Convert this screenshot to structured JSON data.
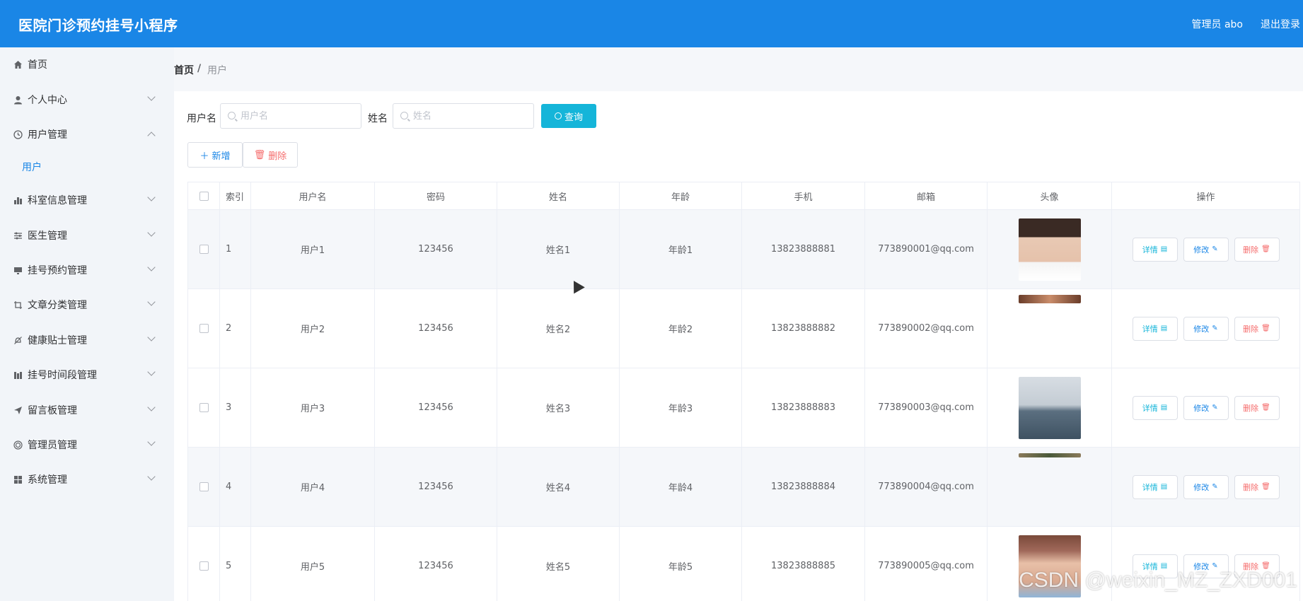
{
  "header": {
    "title": "医院门诊预约挂号小程序",
    "user": "管理员 abo",
    "logout": "退出登录",
    "bg_color": "#1a86e6"
  },
  "sidebar": {
    "items": [
      {
        "label": "首页",
        "icon": "home-icon",
        "expandable": false
      },
      {
        "label": "个人中心",
        "icon": "person-icon",
        "expandable": true
      },
      {
        "label": "用户管理",
        "icon": "clock-icon",
        "expandable": true,
        "expanded": true
      },
      {
        "label": "科室信息管理",
        "icon": "bar-chart-icon",
        "expandable": true
      },
      {
        "label": "医生管理",
        "icon": "sliders-icon",
        "expandable": true
      },
      {
        "label": "挂号预约管理",
        "icon": "monitor-icon",
        "expandable": true
      },
      {
        "label": "文章分类管理",
        "icon": "crop-icon",
        "expandable": true
      },
      {
        "label": "健康贴士管理",
        "icon": "bell-off-icon",
        "expandable": true
      },
      {
        "label": "挂号时间段管理",
        "icon": "columns-icon",
        "expandable": true
      },
      {
        "label": "留言板管理",
        "icon": "send-icon",
        "expandable": true
      },
      {
        "label": "管理员管理",
        "icon": "target-icon",
        "expandable": true
      },
      {
        "label": "系统管理",
        "icon": "grid-icon",
        "expandable": true
      }
    ],
    "submenu": {
      "label": "用户"
    }
  },
  "breadcrumb": {
    "home": "首页",
    "separator": "/",
    "current": "用户"
  },
  "search": {
    "username_label": "用户名",
    "username_placeholder": "用户名",
    "name_label": "姓名",
    "name_placeholder": "姓名",
    "query_label": "查询"
  },
  "actions": {
    "add_label": "新增",
    "delete_label": "删除"
  },
  "table": {
    "columns": [
      "索引",
      "用户名",
      "密码",
      "姓名",
      "年龄",
      "手机",
      "邮箱",
      "头像",
      "操作"
    ],
    "rows": [
      {
        "index": "1",
        "username": "用户1",
        "password": "123456",
        "name": "姓名1",
        "age": "年龄1",
        "phone": "13823888881",
        "email": "773890001@qq.com",
        "avatar": "full"
      },
      {
        "index": "2",
        "username": "用户2",
        "password": "123456",
        "name": "姓名2",
        "age": "年龄2",
        "phone": "13823888882",
        "email": "773890002@qq.com",
        "avatar": "strip"
      },
      {
        "index": "3",
        "username": "用户3",
        "password": "123456",
        "name": "姓名3",
        "age": "年龄3",
        "phone": "13823888883",
        "email": "773890003@qq.com",
        "avatar": "full"
      },
      {
        "index": "4",
        "username": "用户4",
        "password": "123456",
        "name": "姓名4",
        "age": "年龄4",
        "phone": "13823888884",
        "email": "773890004@qq.com",
        "avatar": "strip"
      },
      {
        "index": "5",
        "username": "用户5",
        "password": "123456",
        "name": "姓名5",
        "age": "年龄5",
        "phone": "13823888885",
        "email": "773890005@qq.com",
        "avatar": "full"
      }
    ],
    "op_labels": {
      "detail": "详情",
      "edit": "修改",
      "remove": "删除"
    }
  },
  "watermark": "CSDN @weixin_MZ_ZXD001"
}
